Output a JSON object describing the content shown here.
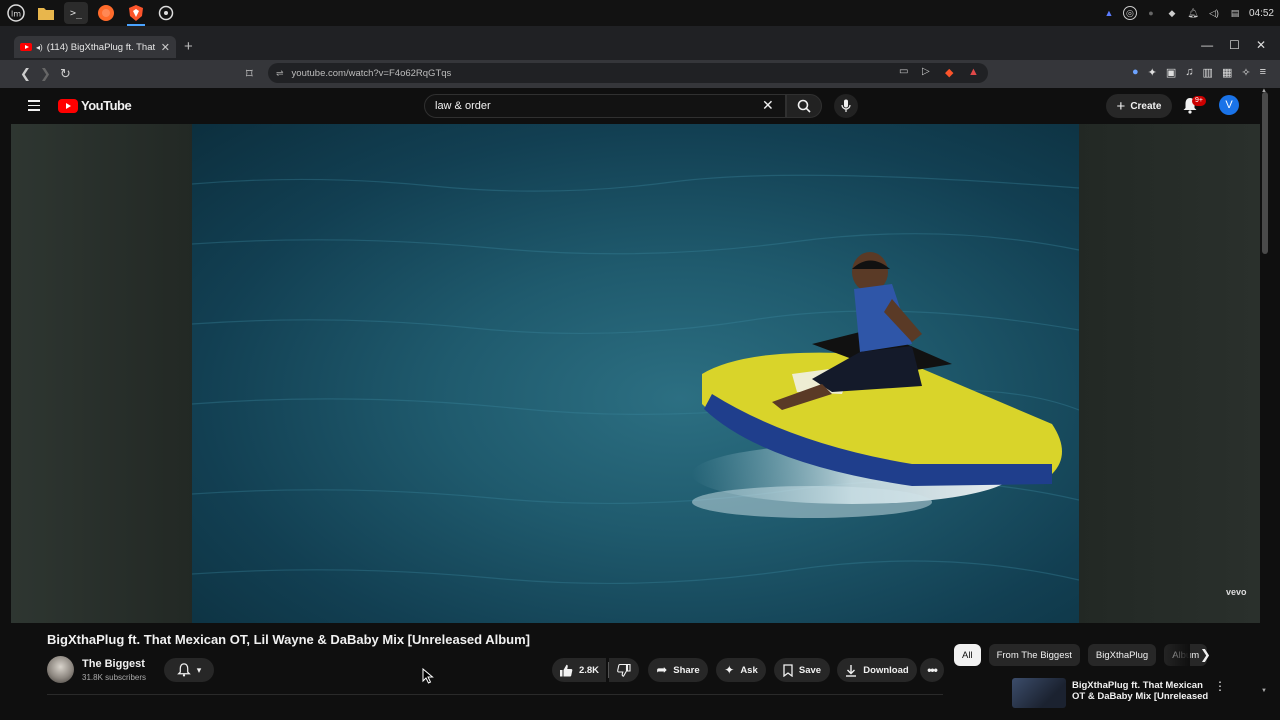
{
  "taskbar": {
    "apps": [
      "mint-menu",
      "files",
      "terminal",
      "firefox",
      "brave",
      "settings"
    ],
    "time": "04:52"
  },
  "browser": {
    "tab_title": "(114) BigXthaPlug ft. That",
    "url": "youtube.com/watch?v=F4o62RqGTqs"
  },
  "youtube": {
    "logo_text": "YouTube",
    "search_value": "law & order",
    "create_label": "Create",
    "notif_badge": "9+",
    "avatar_letter": "V"
  },
  "video": {
    "watermark": "vevo",
    "title": "BigXthaPlug ft. That Mexican OT, Lil Wayne & DaBaby Mix [Unreleased Album]",
    "channel_name": "The Biggest",
    "subscribers": "31.8K subscribers",
    "likes": "2.8K",
    "share_label": "Share",
    "ask_label": "Ask",
    "save_label": "Save",
    "download_label": "Download"
  },
  "sidebar": {
    "chips": [
      "All",
      "From The Biggest",
      "BigXthaPlug",
      "Album"
    ],
    "rec_title": "BigXthaPlug ft. That Mexican OT & DaBaby Mix [Unreleased"
  },
  "colors": {
    "brand_red": "#ff0000",
    "background": "#0f0f0f",
    "accent_blue": "#1a73e8"
  }
}
